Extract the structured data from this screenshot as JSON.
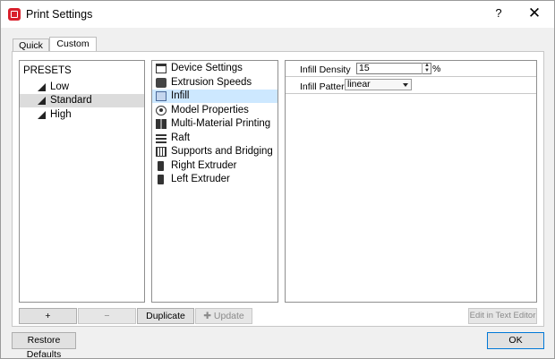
{
  "window": {
    "title": "Print Settings",
    "help_label": "?",
    "close_label": "✕"
  },
  "tabs": [
    {
      "label": "Quick"
    },
    {
      "label": "Custom"
    }
  ],
  "presets": {
    "header": "PRESETS",
    "items": [
      {
        "label": "Low"
      },
      {
        "label": "Standard"
      },
      {
        "label": "High"
      }
    ],
    "selected": "Standard"
  },
  "categories": {
    "items": [
      {
        "label": "Device Settings",
        "icon": "window-icon"
      },
      {
        "label": "Extrusion Speeds",
        "icon": "extrusion-speed-icon"
      },
      {
        "label": "Infill",
        "icon": "infill-cube-icon"
      },
      {
        "label": "Model Properties",
        "icon": "eye-icon"
      },
      {
        "label": "Multi-Material Printing",
        "icon": "multi-material-icon"
      },
      {
        "label": "Raft",
        "icon": "raft-icon"
      },
      {
        "label": "Supports and Bridging",
        "icon": "supports-icon"
      },
      {
        "label": "Right Extruder",
        "icon": "extruder-icon"
      },
      {
        "label": "Left Extruder",
        "icon": "extruder-icon"
      }
    ],
    "selected": "Infill"
  },
  "settings": {
    "infill_density": {
      "label": "Infill Density",
      "value": "15",
      "unit": "%"
    },
    "infill_pattern": {
      "label": "Infill Pattern",
      "value": "linear"
    }
  },
  "buttons": {
    "add": "+",
    "remove": "−",
    "duplicate": "Duplicate",
    "update": "✚ Update",
    "edit_in_text_editor": "Edit in Text Editor",
    "restore_defaults": "Restore Defaults",
    "ok": "OK"
  },
  "colors": {
    "selection_blue": "#cde8ff",
    "selection_gray": "#dcdcdc",
    "app_icon_red": "#d9202c"
  }
}
